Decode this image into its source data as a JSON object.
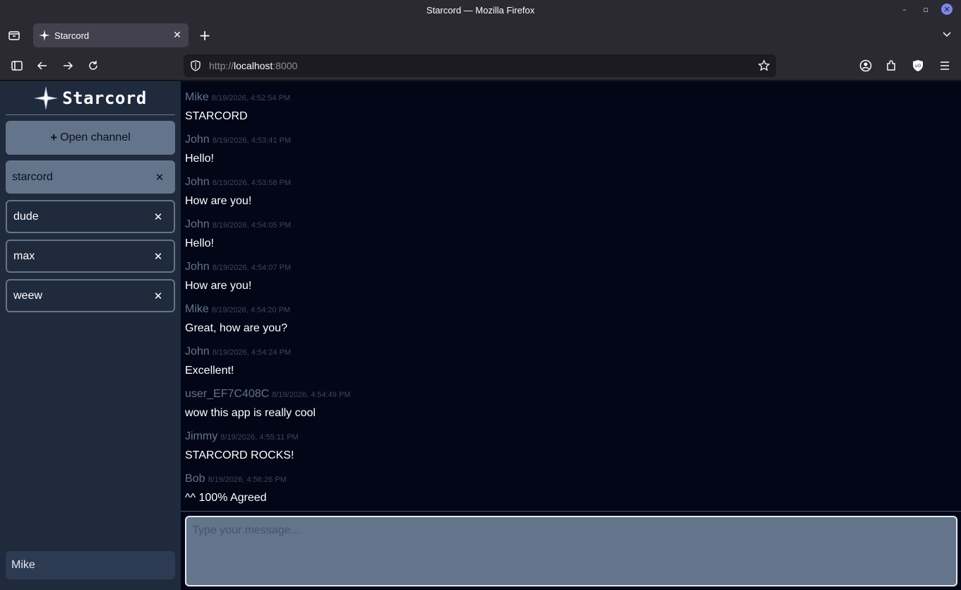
{
  "window": {
    "title": "Starcord — Mozilla Firefox"
  },
  "browser": {
    "tab_title": "Starcord",
    "url_prefix": "http://",
    "url_host": "localhost",
    "url_port": ":8000"
  },
  "app": {
    "logo_text": "Starcord",
    "open_channel_label": "Open channel",
    "channels": [
      {
        "name": "starcord",
        "active": true
      },
      {
        "name": "dude",
        "active": false
      },
      {
        "name": "max",
        "active": false
      },
      {
        "name": "weew",
        "active": false
      }
    ],
    "current_user": "Mike",
    "messages": [
      {
        "author": "Mike",
        "time": "8/19/2026, 4:52:54 PM",
        "text": "STARCORD"
      },
      {
        "author": "John",
        "time": "8/19/2026, 4:53:41 PM",
        "text": "Hello!"
      },
      {
        "author": "John",
        "time": "8/19/2026, 4:53:58 PM",
        "text": "How are you!"
      },
      {
        "author": "John",
        "time": "8/19/2026, 4:54:05 PM",
        "text": "Hello!"
      },
      {
        "author": "John",
        "time": "8/19/2026, 4:54:07 PM",
        "text": "How are you!"
      },
      {
        "author": "Mike",
        "time": "8/19/2026, 4:54:20 PM",
        "text": "Great, how are you?"
      },
      {
        "author": "John",
        "time": "8/19/2026, 4:54:24 PM",
        "text": "Excellent!"
      },
      {
        "author": "user_EF7C408C",
        "time": "8/19/2026, 4:54:49 PM",
        "text": "wow this app is really cool"
      },
      {
        "author": "Jimmy",
        "time": "8/19/2026, 4:55:11 PM",
        "text": "STARCORD ROCKS!"
      },
      {
        "author": "Bob",
        "time": "8/19/2026, 4:56:26 PM",
        "text": "^^ 100% Agreed"
      }
    ],
    "composer_placeholder": "Type your message...",
    "composer_value": ""
  },
  "colors": {
    "sidebar_bg": "#1f2a3d",
    "main_bg": "#020617",
    "accent": "#64748b"
  }
}
